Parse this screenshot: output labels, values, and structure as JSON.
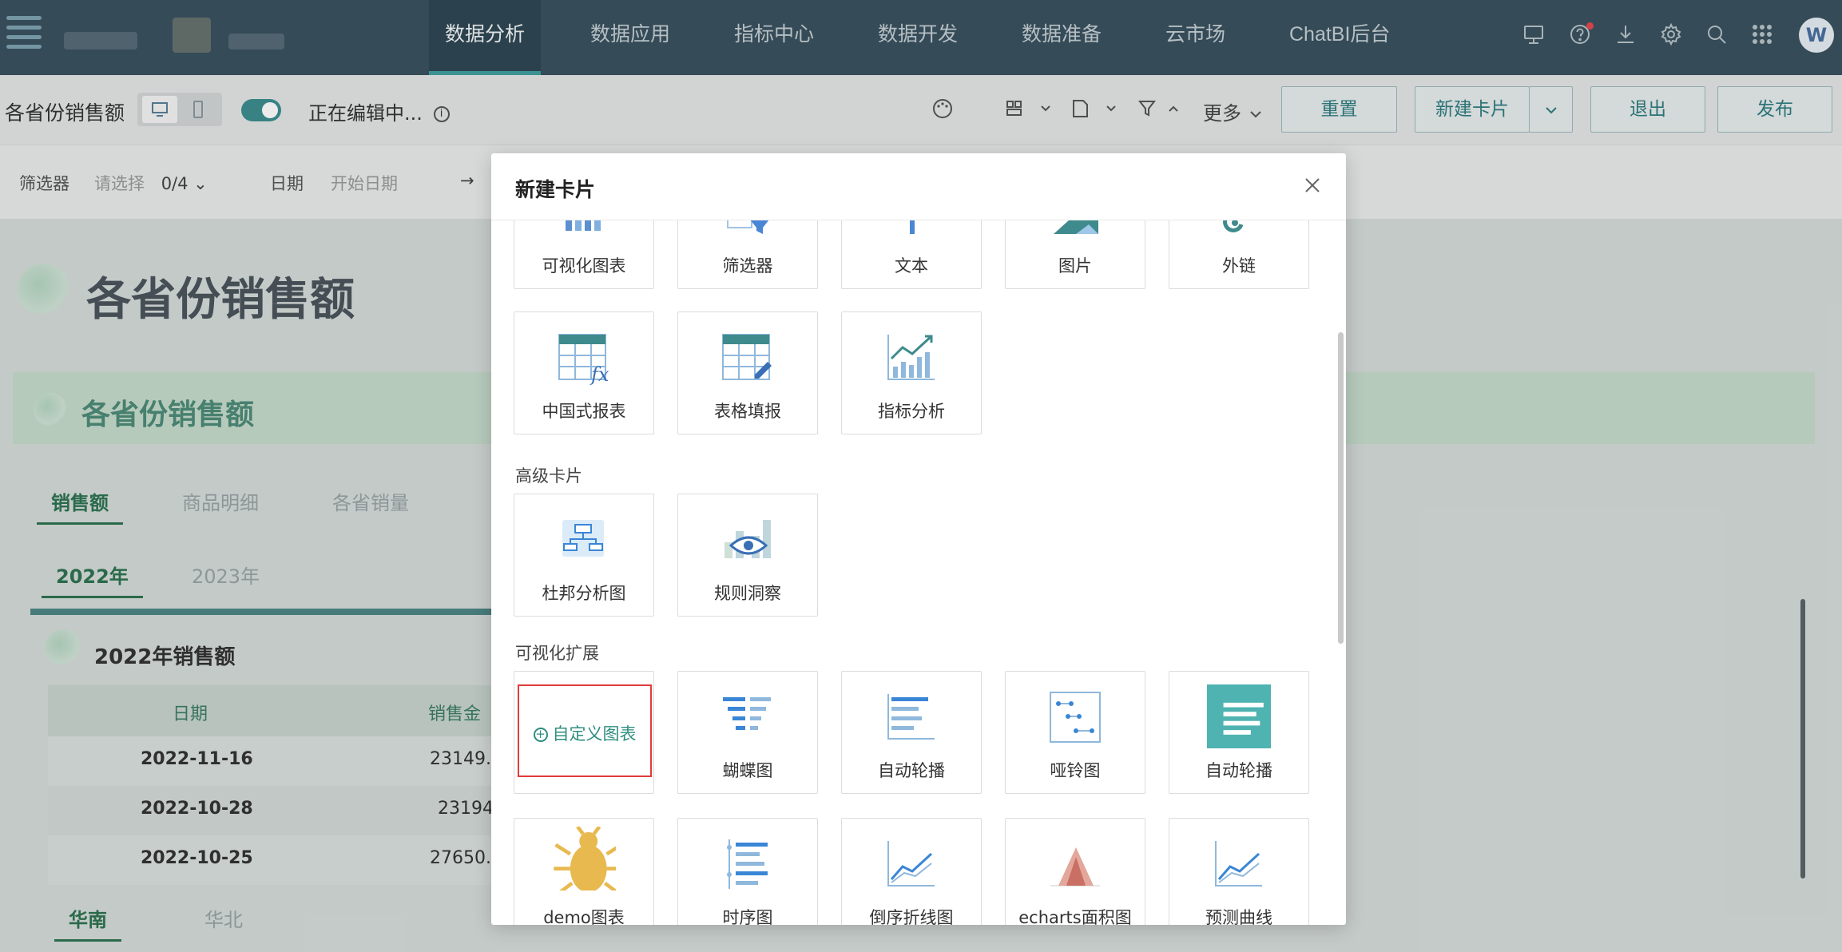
{
  "nav": {
    "items": [
      "数据分析",
      "数据应用",
      "指标中心",
      "数据开发",
      "数据准备",
      "云市场",
      "ChatBI后台"
    ],
    "active": "数据分析",
    "avatar_letter": "W",
    "icons": [
      "screen-icon",
      "help-icon",
      "download-icon",
      "settings-icon",
      "search-icon",
      "apps-grid-icon"
    ]
  },
  "toolbar": {
    "title": "各省份销售额",
    "editing": "正在编辑中...",
    "more": "更多",
    "reset": "重置",
    "new_card": "新建卡片",
    "exit": "退出",
    "publish": "发布"
  },
  "filterbar": {
    "filter_label": "筛选器",
    "filter_placeholder": "请选择",
    "filter_count": "0/4",
    "date_label": "日期",
    "date_placeholder": "开始日期",
    "arrow": "→"
  },
  "dashboard": {
    "title": "各省份销售额",
    "panel_title": "各省份销售额",
    "tabs": [
      "销售额",
      "商品明细",
      "各省销量"
    ],
    "year_tabs": [
      "2022年",
      "2023年"
    ],
    "subtitle": "2022年销售额",
    "table": {
      "headers": [
        "日期",
        "销售金"
      ],
      "rows": [
        [
          "2022-11-16",
          "23149."
        ],
        [
          "2022-10-28",
          "23194"
        ],
        [
          "2022-10-25",
          "27650."
        ]
      ]
    },
    "region_tabs": [
      "华南",
      "华北"
    ]
  },
  "modal": {
    "title": "新建卡片",
    "basic_cards": [
      "可视化图表",
      "筛选器",
      "文本",
      "图片",
      "外链",
      "中国式报表",
      "表格填报",
      "指标分析"
    ],
    "advanced_label": "高级卡片",
    "advanced_cards": [
      "杜邦分析图",
      "规则洞察"
    ],
    "extension_label": "可视化扩展",
    "custom_chart": "自定义图表",
    "extension_cards": [
      "蝴蝶图",
      "自动轮播",
      "哑铃图",
      "自动轮播"
    ],
    "extension_cards_row2": [
      "demo图表",
      "时序图",
      "倒序折线图",
      "echarts面积图",
      "预测曲线"
    ]
  },
  "colors": {
    "nav_bg": "#3a5260",
    "accent": "#3f9fa0",
    "highlight_border": "#e23b3b"
  }
}
